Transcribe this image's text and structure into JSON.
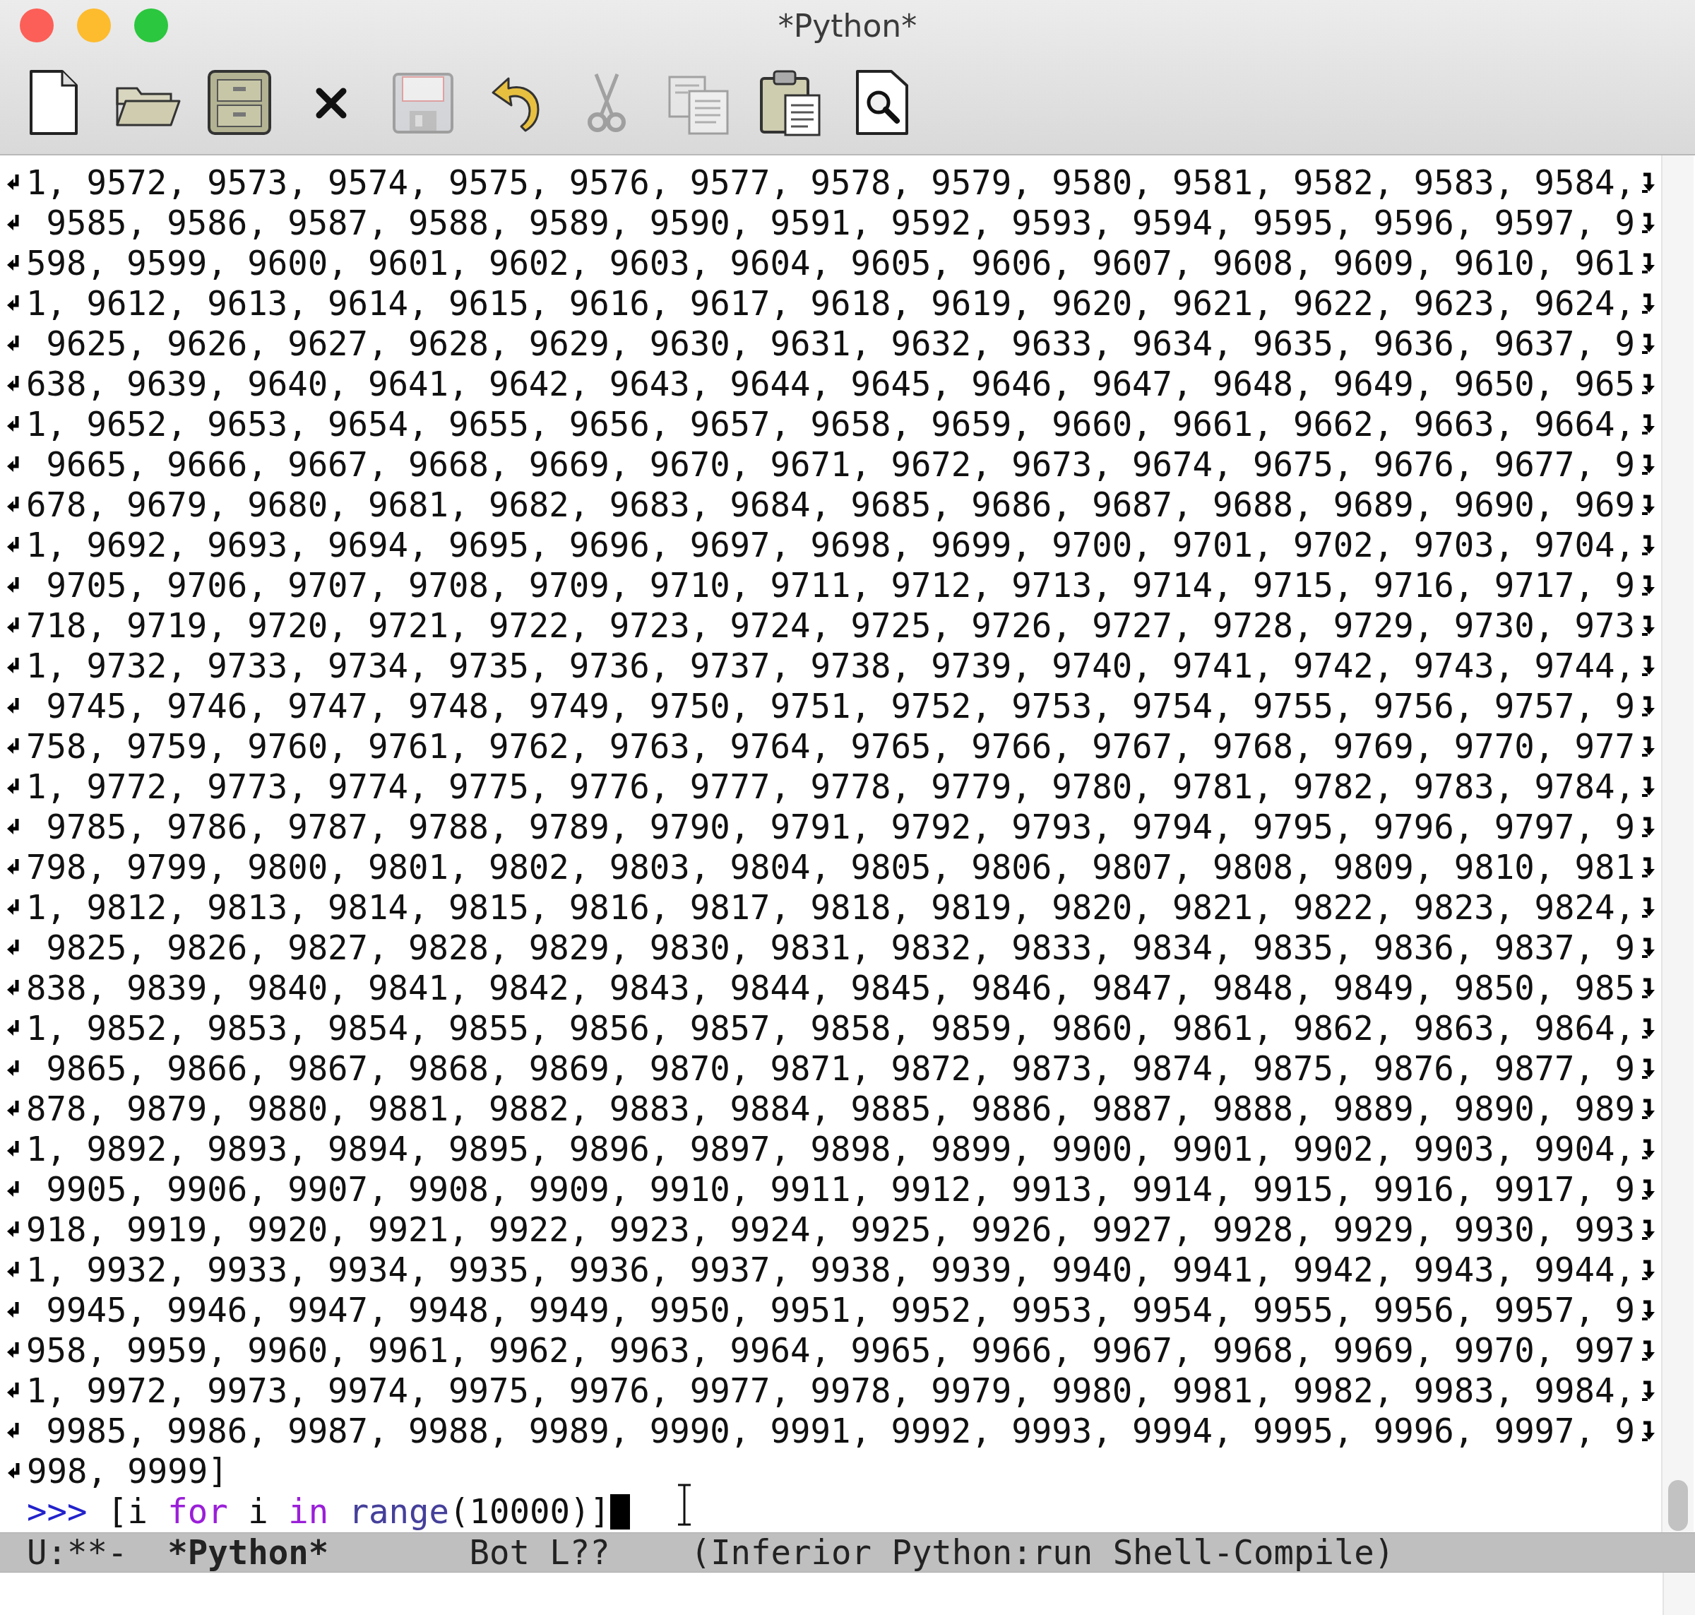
{
  "window": {
    "title": "*Python*"
  },
  "toolbar": [
    {
      "kind": "new",
      "disabled": false
    },
    {
      "kind": "open",
      "disabled": false
    },
    {
      "kind": "dired",
      "disabled": false
    },
    {
      "kind": "kill",
      "disabled": false
    },
    {
      "kind": "save",
      "disabled": true
    },
    {
      "kind": "undo",
      "disabled": false
    },
    {
      "kind": "cut",
      "disabled": true
    },
    {
      "kind": "copy",
      "disabled": true
    },
    {
      "kind": "paste",
      "disabled": false
    },
    {
      "kind": "search",
      "disabled": false
    }
  ],
  "buffer": {
    "lines": [
      {
        "text": "1, 9572, 9573, 9574, 9575, 9576, 9577, 9578, 9579, 9580, 9581, 9582, 9583, 9584,",
        "continued": true,
        "continues": true
      },
      {
        "text": " 9585, 9586, 9587, 9588, 9589, 9590, 9591, 9592, 9593, 9594, 9595, 9596, 9597, 9",
        "continued": true,
        "continues": true
      },
      {
        "text": "598, 9599, 9600, 9601, 9602, 9603, 9604, 9605, 9606, 9607, 9608, 9609, 9610, 961",
        "continued": true,
        "continues": true
      },
      {
        "text": "1, 9612, 9613, 9614, 9615, 9616, 9617, 9618, 9619, 9620, 9621, 9622, 9623, 9624,",
        "continued": true,
        "continues": true
      },
      {
        "text": " 9625, 9626, 9627, 9628, 9629, 9630, 9631, 9632, 9633, 9634, 9635, 9636, 9637, 9",
        "continued": true,
        "continues": true
      },
      {
        "text": "638, 9639, 9640, 9641, 9642, 9643, 9644, 9645, 9646, 9647, 9648, 9649, 9650, 965",
        "continued": true,
        "continues": true
      },
      {
        "text": "1, 9652, 9653, 9654, 9655, 9656, 9657, 9658, 9659, 9660, 9661, 9662, 9663, 9664,",
        "continued": true,
        "continues": true
      },
      {
        "text": " 9665, 9666, 9667, 9668, 9669, 9670, 9671, 9672, 9673, 9674, 9675, 9676, 9677, 9",
        "continued": true,
        "continues": true
      },
      {
        "text": "678, 9679, 9680, 9681, 9682, 9683, 9684, 9685, 9686, 9687, 9688, 9689, 9690, 969",
        "continued": true,
        "continues": true
      },
      {
        "text": "1, 9692, 9693, 9694, 9695, 9696, 9697, 9698, 9699, 9700, 9701, 9702, 9703, 9704,",
        "continued": true,
        "continues": true
      },
      {
        "text": " 9705, 9706, 9707, 9708, 9709, 9710, 9711, 9712, 9713, 9714, 9715, 9716, 9717, 9",
        "continued": true,
        "continues": true
      },
      {
        "text": "718, 9719, 9720, 9721, 9722, 9723, 9724, 9725, 9726, 9727, 9728, 9729, 9730, 973",
        "continued": true,
        "continues": true
      },
      {
        "text": "1, 9732, 9733, 9734, 9735, 9736, 9737, 9738, 9739, 9740, 9741, 9742, 9743, 9744,",
        "continued": true,
        "continues": true
      },
      {
        "text": " 9745, 9746, 9747, 9748, 9749, 9750, 9751, 9752, 9753, 9754, 9755, 9756, 9757, 9",
        "continued": true,
        "continues": true
      },
      {
        "text": "758, 9759, 9760, 9761, 9762, 9763, 9764, 9765, 9766, 9767, 9768, 9769, 9770, 977",
        "continued": true,
        "continues": true
      },
      {
        "text": "1, 9772, 9773, 9774, 9775, 9776, 9777, 9778, 9779, 9780, 9781, 9782, 9783, 9784,",
        "continued": true,
        "continues": true
      },
      {
        "text": " 9785, 9786, 9787, 9788, 9789, 9790, 9791, 9792, 9793, 9794, 9795, 9796, 9797, 9",
        "continued": true,
        "continues": true
      },
      {
        "text": "798, 9799, 9800, 9801, 9802, 9803, 9804, 9805, 9806, 9807, 9808, 9809, 9810, 981",
        "continued": true,
        "continues": true
      },
      {
        "text": "1, 9812, 9813, 9814, 9815, 9816, 9817, 9818, 9819, 9820, 9821, 9822, 9823, 9824,",
        "continued": true,
        "continues": true
      },
      {
        "text": " 9825, 9826, 9827, 9828, 9829, 9830, 9831, 9832, 9833, 9834, 9835, 9836, 9837, 9",
        "continued": true,
        "continues": true
      },
      {
        "text": "838, 9839, 9840, 9841, 9842, 9843, 9844, 9845, 9846, 9847, 9848, 9849, 9850, 985",
        "continued": true,
        "continues": true
      },
      {
        "text": "1, 9852, 9853, 9854, 9855, 9856, 9857, 9858, 9859, 9860, 9861, 9862, 9863, 9864,",
        "continued": true,
        "continues": true
      },
      {
        "text": " 9865, 9866, 9867, 9868, 9869, 9870, 9871, 9872, 9873, 9874, 9875, 9876, 9877, 9",
        "continued": true,
        "continues": true
      },
      {
        "text": "878, 9879, 9880, 9881, 9882, 9883, 9884, 9885, 9886, 9887, 9888, 9889, 9890, 989",
        "continued": true,
        "continues": true
      },
      {
        "text": "1, 9892, 9893, 9894, 9895, 9896, 9897, 9898, 9899, 9900, 9901, 9902, 9903, 9904,",
        "continued": true,
        "continues": true
      },
      {
        "text": " 9905, 9906, 9907, 9908, 9909, 9910, 9911, 9912, 9913, 9914, 9915, 9916, 9917, 9",
        "continued": true,
        "continues": true
      },
      {
        "text": "918, 9919, 9920, 9921, 9922, 9923, 9924, 9925, 9926, 9927, 9928, 9929, 9930, 993",
        "continued": true,
        "continues": true
      },
      {
        "text": "1, 9932, 9933, 9934, 9935, 9936, 9937, 9938, 9939, 9940, 9941, 9942, 9943, 9944,",
        "continued": true,
        "continues": true
      },
      {
        "text": " 9945, 9946, 9947, 9948, 9949, 9950, 9951, 9952, 9953, 9954, 9955, 9956, 9957, 9",
        "continued": true,
        "continues": true
      },
      {
        "text": "958, 9959, 9960, 9961, 9962, 9963, 9964, 9965, 9966, 9967, 9968, 9969, 9970, 997",
        "continued": true,
        "continues": true
      },
      {
        "text": "1, 9972, 9973, 9974, 9975, 9976, 9977, 9978, 9979, 9980, 9981, 9982, 9983, 9984,",
        "continued": true,
        "continues": true
      },
      {
        "text": " 9985, 9986, 9987, 9988, 9989, 9990, 9991, 9992, 9993, 9994, 9995, 9996, 9997, 9",
        "continued": true,
        "continues": true
      },
      {
        "text": "998, 9999]",
        "continued": true,
        "continues": false
      }
    ],
    "prompt": {
      "tokens": [
        {
          "text": ">>>",
          "kind": "prompt"
        },
        {
          "text": " [i ",
          "kind": "plain"
        },
        {
          "text": "for",
          "kind": "keyword"
        },
        {
          "text": " i ",
          "kind": "plain"
        },
        {
          "text": "in",
          "kind": "keyword"
        },
        {
          "text": " range",
          "kind": "builtin"
        },
        {
          "text": "(10000)]",
          "kind": "plain"
        }
      ]
    }
  },
  "mode_line": {
    "segments": [
      {
        "text": "U:**-",
        "kind": "plain"
      },
      {
        "text": "*Python*",
        "kind": "buffer"
      },
      {
        "text": "Bot L??",
        "kind": "plain"
      },
      {
        "text": "(Inferior Python:run Shell-Compile)",
        "kind": "plain"
      }
    ]
  }
}
